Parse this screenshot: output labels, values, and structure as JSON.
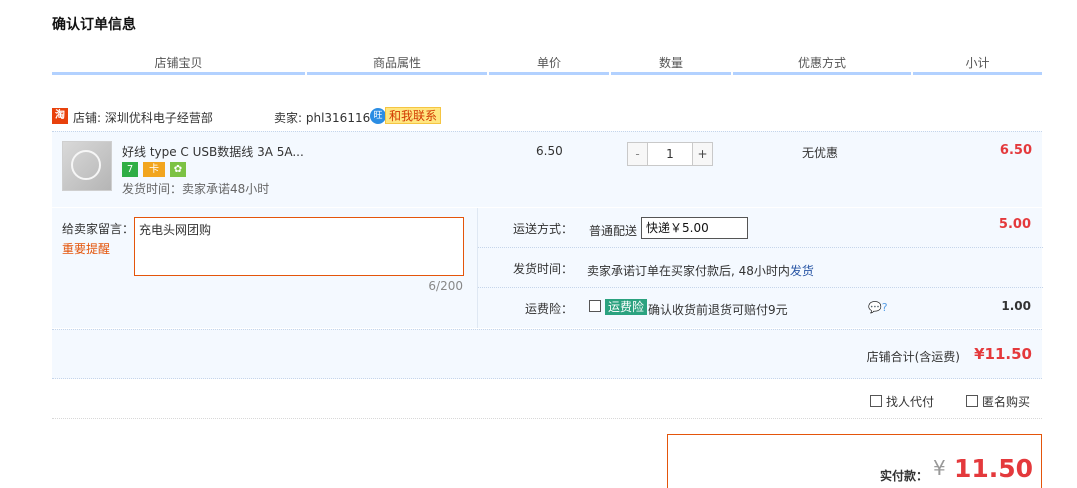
{
  "page": {
    "title": "确认订单信息"
  },
  "table_headers": [
    "店铺宝贝",
    "商品属性",
    "单价",
    "数量",
    "优惠方式",
    "小计"
  ],
  "shop": {
    "icon_label": "淘",
    "name_label": "店铺: 深圳优科电子经营部",
    "seller_label": "卖家: phl316116",
    "ww_icon_label": "旺",
    "contact_label": "和我联系"
  },
  "item": {
    "title": "好线 type C USB数据线 3A 5A...",
    "badges": [
      "7",
      "卡",
      "✿"
    ],
    "ship_time": "发货时间：卖家承诺48小时",
    "price": "6.50",
    "quantity": "1",
    "qty_minus": "-",
    "qty_plus": "+",
    "discount": "无优惠",
    "subtotal": "6.50"
  },
  "message": {
    "label": "给卖家留言：",
    "remind": "重要提醒",
    "value": "充电头网团购",
    "count": "6/200"
  },
  "shipping": {
    "method_label": "运送方式：",
    "normal_label": "普通配送",
    "selected": "快递￥5.00",
    "amount": "5.00",
    "time_label": "发货时间：",
    "time_text": "卖家承诺订单在买家付款后, 48小时内",
    "time_link": "发货",
    "insurance_label": "运费险：",
    "insurance_tag": "运费险",
    "insurance_desc": "确认收货前退货可赔付9元",
    "insurance_icons": "💬?",
    "insurance_amount": "1.00"
  },
  "shop_total": {
    "label": "店铺合计(含运费)",
    "value": "¥11.50"
  },
  "options": {
    "agent_pay": "找人代付",
    "anonymous": "匿名购买"
  },
  "payment": {
    "label": "实付款：",
    "currency": "¥",
    "amount": "11.50"
  },
  "colors": {
    "accent_red": "#e4393c",
    "accent_orange": "#e4550b",
    "header_line": "#b2d1ff",
    "row_bg": "#f4f9ff"
  }
}
